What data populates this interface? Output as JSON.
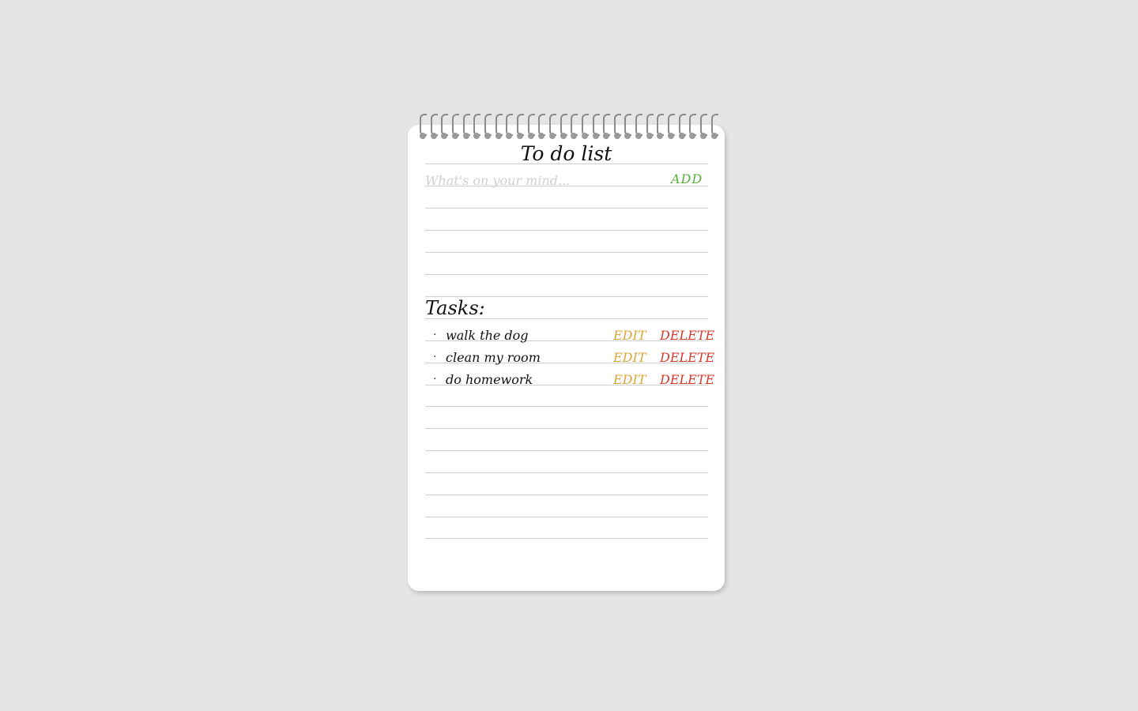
{
  "app": {
    "title": "To do list"
  },
  "input": {
    "placeholder": "What's on your mind...",
    "value": "",
    "add_label": "ADD"
  },
  "tasks_heading": "Tasks:",
  "tasks": [
    {
      "bullet": "·",
      "text": "walk the dog",
      "edit_label": "EDIT",
      "delete_label": "DELETE"
    },
    {
      "bullet": "·",
      "text": "clean my room",
      "edit_label": "EDIT",
      "delete_label": "DELETE"
    },
    {
      "bullet": "·",
      "text": "do homework",
      "edit_label": "EDIT",
      "delete_label": "DELETE"
    }
  ],
  "colors": {
    "background": "#e5e5e5",
    "paper": "#ffffff",
    "rule": "#cfcfcf",
    "add": "#5aad3a",
    "edit": "#d8a73a",
    "delete": "#d53a2a"
  }
}
